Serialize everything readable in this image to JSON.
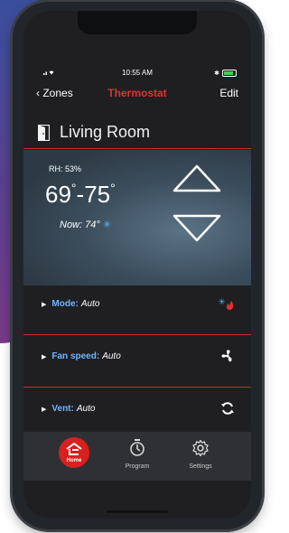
{
  "status_bar": {
    "time": "10:55 AM",
    "battery_level": 0.8
  },
  "nav": {
    "back_label": "Zones",
    "title": "Thermostat",
    "edit_label": "Edit"
  },
  "zone": {
    "name": "Living Room"
  },
  "climate": {
    "humidity_label": "RH: 53%",
    "heat_setpoint": "69",
    "cool_setpoint": "75",
    "now_label": "Now: 74°"
  },
  "controls": [
    {
      "label": "Mode:",
      "value": "Auto",
      "icon": "heat-cool-icon"
    },
    {
      "label": "Fan speed:",
      "value": "Auto",
      "icon": "fan-icon"
    },
    {
      "label": "Vent:",
      "value": "Auto",
      "icon": "refresh-icon"
    }
  ],
  "tabs": [
    {
      "label": "Home",
      "icon": "home-icon",
      "active": true
    },
    {
      "label": "Program",
      "icon": "timer-icon",
      "active": false
    },
    {
      "label": "Settings",
      "icon": "gear-icon",
      "active": false
    }
  ],
  "colors": {
    "accent_red": "#e0322f",
    "label_blue": "#6fb5ff",
    "snow_blue": "#5fb6ff"
  }
}
